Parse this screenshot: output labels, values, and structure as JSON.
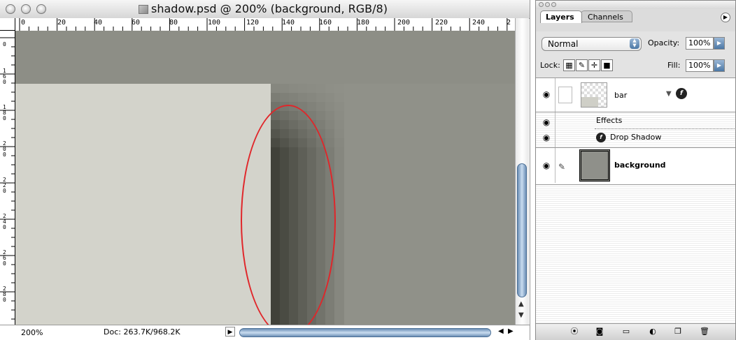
{
  "document": {
    "title": "shadow.psd @ 200% (background, RGB/8)",
    "ruler_h_labels": [
      "0",
      "20",
      "40",
      "60",
      "80",
      "100",
      "120",
      "140",
      "160",
      "180",
      "200",
      "220",
      "240",
      "2"
    ],
    "ruler_v_labels": [
      "0",
      "1 6 0",
      "1 8 0",
      "2 0 0",
      "2 2 0",
      "2 4 0",
      "2 6 0",
      "2 8 0"
    ],
    "zoom": "200%",
    "doc_info": "Doc: 263.7K/968.2K"
  },
  "palette": {
    "tabs": [
      "Layers",
      "Channels"
    ],
    "blend_mode": "Normal",
    "opacity_label": "Opacity:",
    "opacity_value": "100%",
    "lock_label": "Lock:",
    "fill_label": "Fill:",
    "fill_value": "100%",
    "layers": {
      "bar": "bar",
      "effects": "Effects",
      "drop_shadow": "Drop Shadow",
      "background": "background"
    }
  },
  "colors": {
    "canvas_bg": "#909189",
    "bar_layer": "#d3d3cb",
    "annotation_oval": "#e0262a",
    "scroll_accent": "#6c8fb5"
  }
}
